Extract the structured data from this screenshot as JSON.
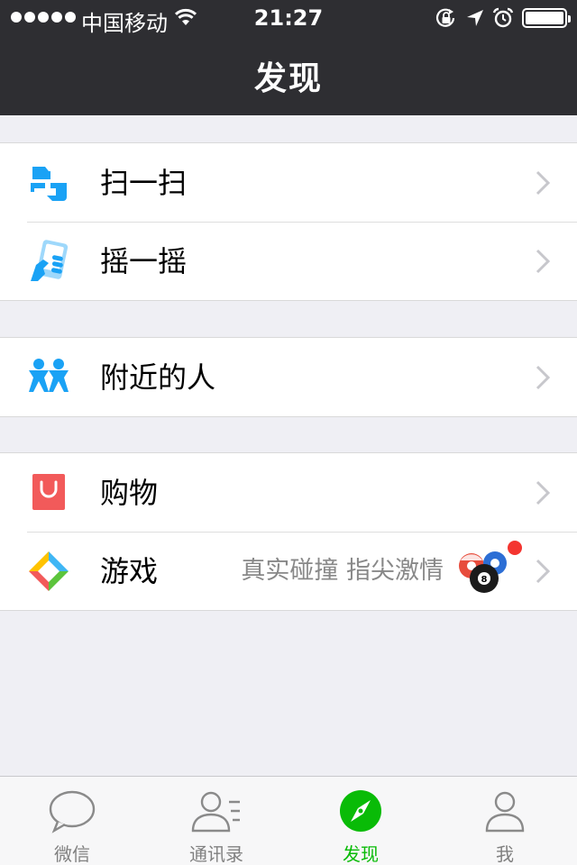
{
  "status_bar": {
    "carrier": "中国移动",
    "time": "21:27",
    "signal_icon": "signal-dots-icon",
    "wifi_icon": "wifi-icon",
    "lock_icon": "rotation-lock-icon",
    "location_icon": "location-arrow-icon",
    "alarm_icon": "alarm-clock-icon",
    "battery_icon": "battery-icon",
    "battery_level": 1.0
  },
  "nav": {
    "title": "发现"
  },
  "groups": [
    {
      "items": [
        {
          "label": "扫一扫",
          "icon": "scan-icon",
          "color": "#1aa2f5"
        },
        {
          "label": "摇一摇",
          "icon": "shake-phone-icon",
          "color": "#1aa2f5"
        }
      ]
    },
    {
      "items": [
        {
          "label": "附近的人",
          "icon": "nearby-people-icon",
          "color": "#1aa2f5"
        }
      ]
    },
    {
      "items": [
        {
          "label": "购物",
          "icon": "shopping-bag-icon",
          "color": "#f25a5a"
        },
        {
          "label": "游戏",
          "icon": "game-icon",
          "subtitle": "真实碰撞 指尖激情",
          "badge": "red-dot",
          "thumbnail": "billiard-balls-icon"
        }
      ]
    }
  ],
  "tabbar": {
    "tabs": [
      {
        "label": "微信",
        "icon": "chat-bubble-icon",
        "active": false
      },
      {
        "label": "通讯录",
        "icon": "contacts-icon",
        "active": false
      },
      {
        "label": "发现",
        "icon": "compass-icon",
        "active": true
      },
      {
        "label": "我",
        "icon": "me-person-icon",
        "active": false
      }
    ],
    "active_color": "#09bb07",
    "inactive_color": "#808080"
  }
}
